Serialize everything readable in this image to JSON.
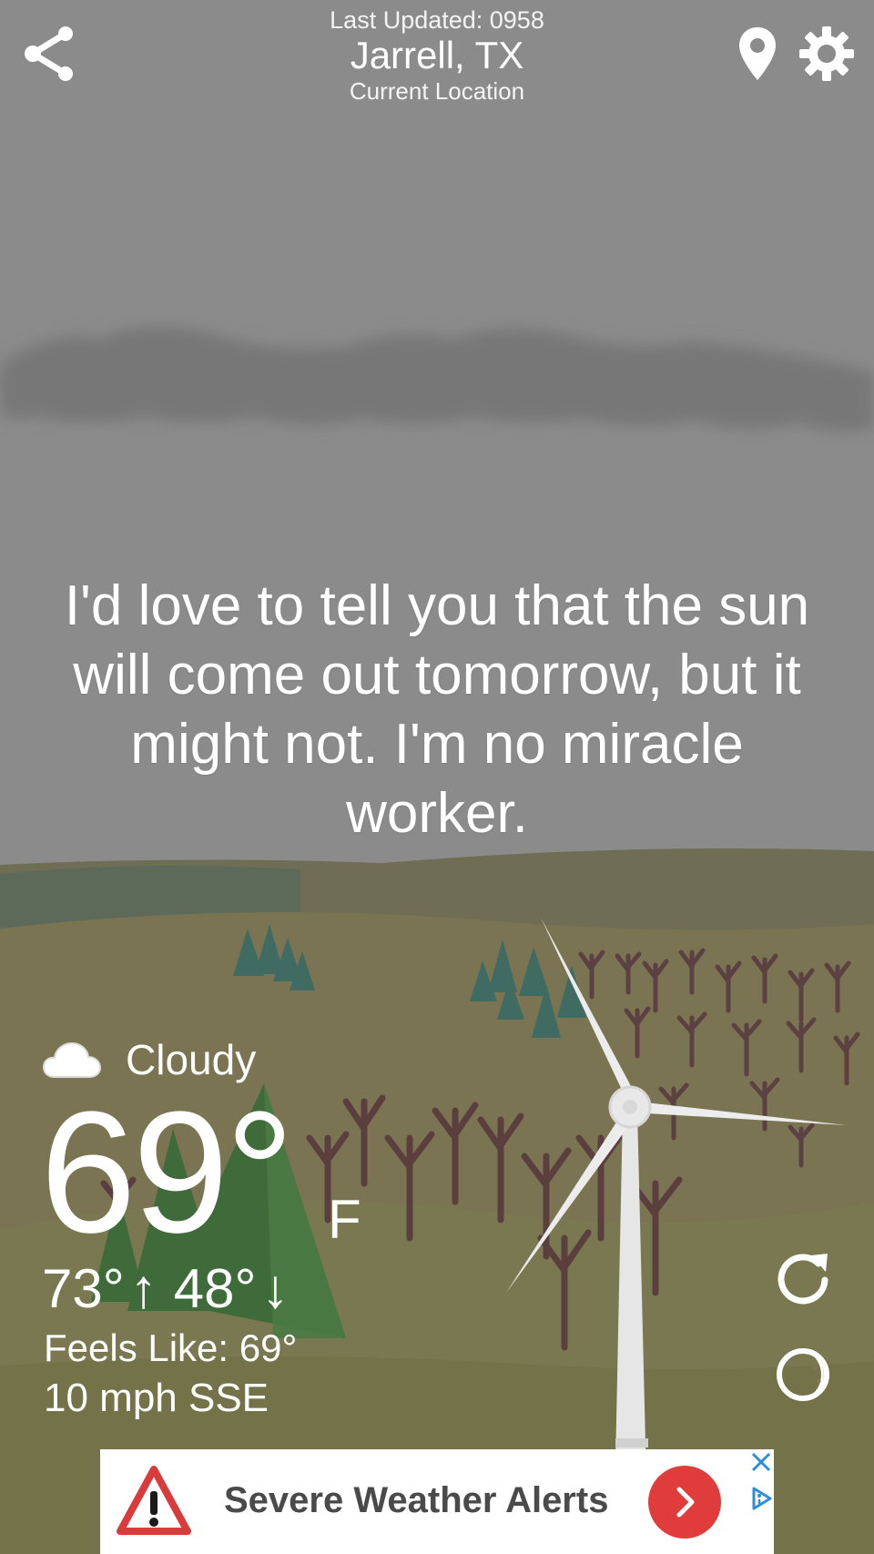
{
  "header": {
    "last_updated": "Last Updated: 0958",
    "city": "Jarrell, TX",
    "location_label": "Current Location"
  },
  "quote": "I'd love to tell you that the sun will come out tomorrow, but it might not. I'm no miracle worker.",
  "weather": {
    "condition": "Cloudy",
    "temperature": "69°",
    "unit": "F",
    "high": "73°",
    "high_arrow": "↑",
    "low": "48°",
    "low_arrow": "↓",
    "feels_like": "Feels Like: 69°",
    "wind": "10 mph SSE"
  },
  "ad": {
    "title": "Severe Weather Alerts"
  },
  "icons": {
    "share": "share-icon",
    "pin": "location-pin-icon",
    "settings": "gear-icon",
    "condition": "cloud-icon",
    "refresh": "refresh-icon",
    "moon": "moon-icon",
    "ad_warning": "warning-triangle-icon",
    "ad_arrow": "chevron-right-icon",
    "ad_close": "close-icon",
    "ad_choices": "adchoices-icon"
  },
  "colors": {
    "sky": "#8b8b8b",
    "cloud_band": "#7a7a7a",
    "hills": "#7a7450",
    "ad_arrow": "#e03c3c"
  }
}
